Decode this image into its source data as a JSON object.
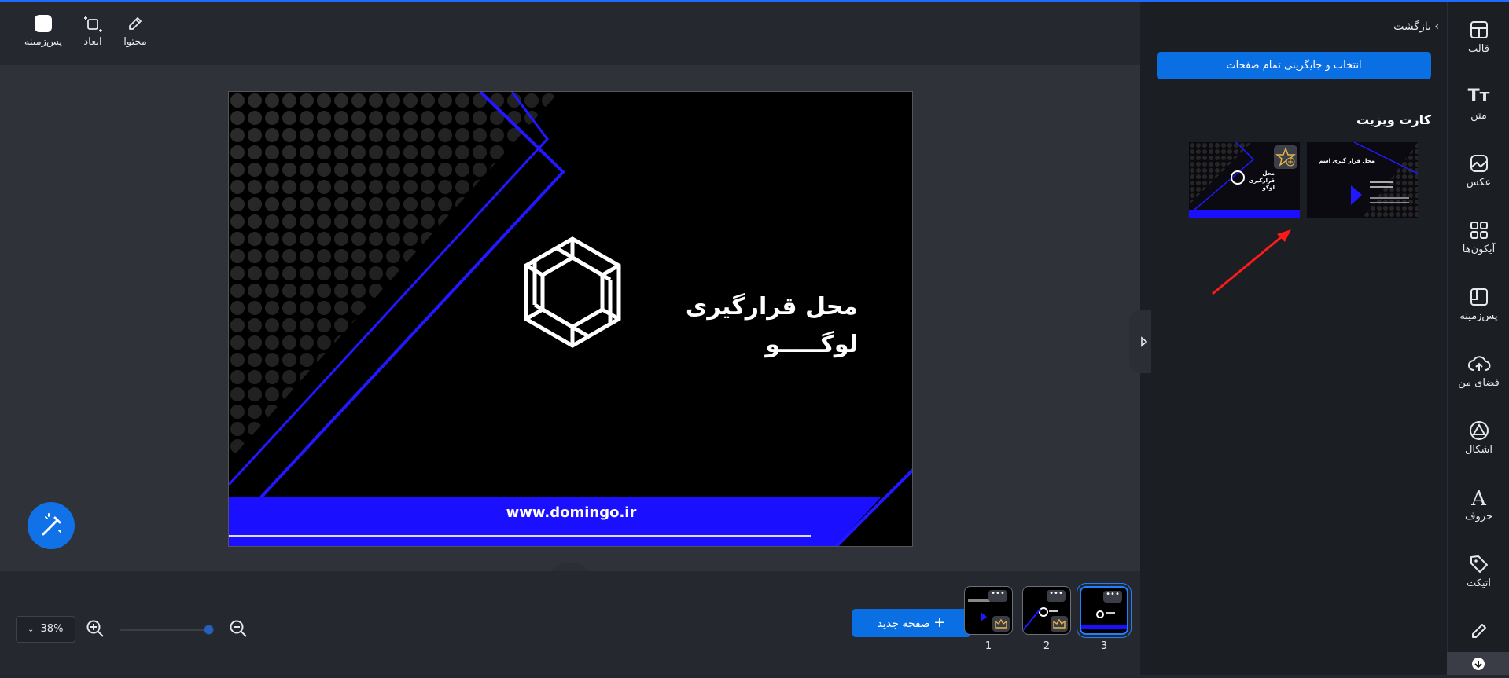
{
  "toolbar": {
    "tools": [
      {
        "label": "محتوا",
        "icon": "edit-icon"
      },
      {
        "label": "ابعاد",
        "icon": "resize-icon"
      },
      {
        "label": "پس‌زمینه",
        "icon": "background-color-icon"
      }
    ]
  },
  "canvas": {
    "title_line1": "محل قرارگیری",
    "title_line2": "لوگـــــو",
    "url": "www.domingo.ir",
    "colors": {
      "background": "#000000",
      "accent": "#1a10ff"
    }
  },
  "bottombar": {
    "zoom_value": "38%",
    "zoom_fraction": 0.75,
    "new_page_label": "صفحه جدید",
    "pages": [
      {
        "number": "1",
        "active": false
      },
      {
        "number": "2",
        "active": false
      },
      {
        "number": "3",
        "active": true
      }
    ]
  },
  "panel": {
    "back_label": "بازگشت",
    "replace_all_label": "انتخاب و جایگزینی تمام صفحات",
    "section_title": "کارت ویزیت",
    "template1_title": "محل قرارگیری لوگو",
    "template2_title": "محل قرار گیری اسم"
  },
  "sidebar": {
    "items": [
      {
        "label": "قالب",
        "icon": "template-icon"
      },
      {
        "label": "متن",
        "icon": "text-icon"
      },
      {
        "label": "عکس",
        "icon": "image-icon"
      },
      {
        "label": "آیکون‌ها",
        "icon": "icons-grid-icon"
      },
      {
        "label": "پس‌زمینه",
        "icon": "background-icon"
      },
      {
        "label": "فضای من",
        "icon": "cloud-upload-icon"
      },
      {
        "label": "اشکال",
        "icon": "shapes-icon"
      },
      {
        "label": "حروف",
        "icon": "letters-icon"
      },
      {
        "label": "اتیکت",
        "icon": "tag-icon"
      }
    ]
  }
}
